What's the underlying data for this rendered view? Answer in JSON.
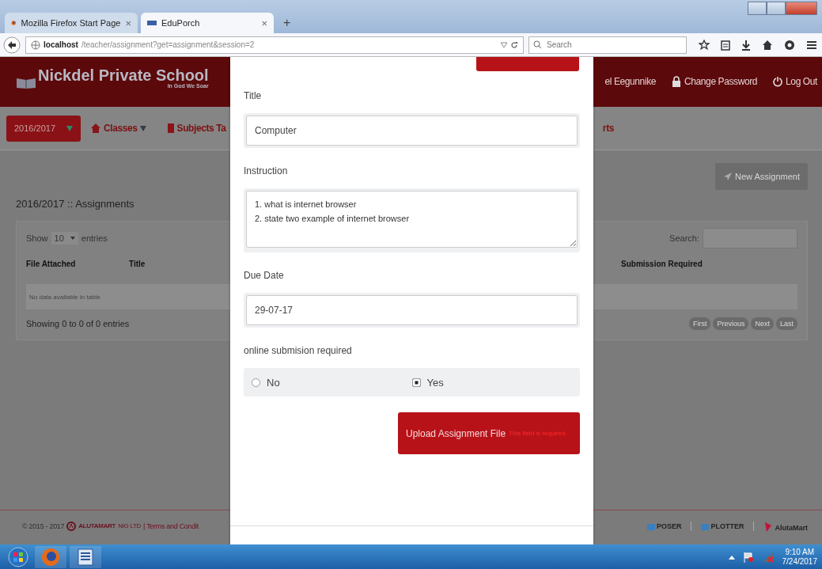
{
  "browser": {
    "tabs": [
      {
        "label": "Mozilla Firefox Start Page",
        "close": "×",
        "selected": false
      },
      {
        "label": "EduPorch",
        "close": "×",
        "selected": true
      }
    ],
    "new_tab": "+",
    "url": {
      "host": "localhost",
      "path": "/teacher/assignment?get=assignment&session=2"
    },
    "search": {
      "placeholder": "Search"
    }
  },
  "header": {
    "school": "Nickdel Private School",
    "motto": "In God We Soar",
    "user": "el Eegunnike",
    "links": [
      "Change Password",
      "Log Out"
    ]
  },
  "nav": {
    "session": "2016/2017",
    "items": [
      {
        "label": "Classes",
        "caret": true
      },
      {
        "label": "Subjects Ta",
        "caret": false
      }
    ],
    "cut_item": "rts"
  },
  "main": {
    "new_button": "New Assignment",
    "heading": "2016/2017 :: Assignments",
    "show": "Show",
    "page_size": "10",
    "entries": "entries",
    "search_label": "Search:",
    "columns": [
      "File Attached",
      "Title",
      "Submission Required"
    ],
    "empty": "No data available in table",
    "info": "Showing 0 to 0 of 0 entries",
    "pager": [
      "First",
      "Previous",
      "Next",
      "Last"
    ]
  },
  "footer": {
    "copyright": "© 2015 - 2017",
    "brand": "ALUTAMART",
    "brand_suffix": "NIG LTD",
    "terms": "| Terms and Condit",
    "logos": [
      "POSER",
      "PLOTTER",
      "AlutaMart"
    ]
  },
  "modal": {
    "fields": [
      {
        "kind": "text",
        "label": "Title",
        "value": "Computer"
      },
      {
        "kind": "textarea",
        "label": "Instruction",
        "value": "1. what is internet browser\n2. state two example of internet browser"
      },
      {
        "kind": "text",
        "label": "Due Date",
        "value": "29-07-17"
      },
      {
        "kind": "radio",
        "label": "online submision required",
        "options": [
          {
            "label": "No",
            "selected": false
          },
          {
            "label": "Yes",
            "selected": true
          }
        ]
      }
    ],
    "upload": {
      "label": "Upload Assignment File",
      "error": "This field is required"
    }
  },
  "taskbar": {
    "time": "9:10 AM",
    "date": "7/24/2017"
  }
}
